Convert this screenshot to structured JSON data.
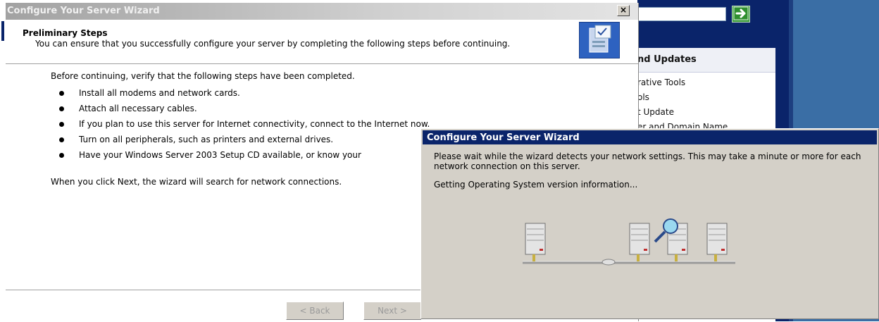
{
  "background_window": {
    "search_value": "",
    "tools_card_heading": "nd Updates",
    "tool_links": [
      "rative Tools",
      "ols",
      "t Update",
      "er and Domain Name"
    ],
    "go_button_icon": "arrow-right-icon"
  },
  "wizard": {
    "title": "Configure Your Server Wizard",
    "close_label": "×",
    "header_title": "Preliminary Steps",
    "header_description": "You can ensure that you successfully configure your server by completing the following steps before continuing.",
    "intro": "Before continuing, verify that the following steps have been completed.",
    "steps": [
      "Install all modems and network cards.",
      "Attach all necessary cables.",
      "If you plan to use this server for Internet connectivity, connect to the Internet now.",
      "Turn on all peripherals, such as printers and external drives.",
      "Have your Windows Server 2003 Setup CD available, or know your"
    ],
    "outro": "When you click Next, the wizard will search for network connections.",
    "back_label": "< Back",
    "next_label": "Next >"
  },
  "progress_dialog": {
    "title": "Configure Your Server Wizard",
    "message": "Please wait while the wizard detects your network settings. This may take a minute or more for each network connection on this server.",
    "status": "Getting Operating System version information..."
  },
  "colors": {
    "active_title": "#0a246a",
    "inactive_title": "#a2a2a2",
    "dialog_face": "#d4d0c8",
    "desktop_blue": "#3a6ea5"
  }
}
